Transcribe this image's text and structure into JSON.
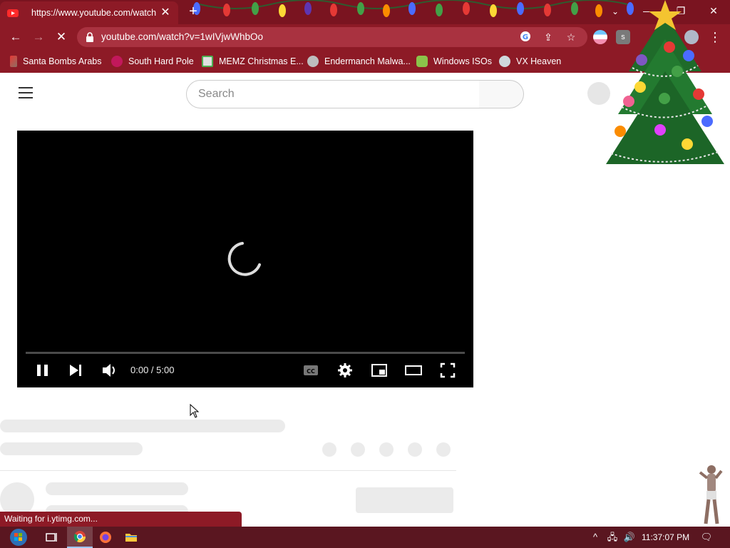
{
  "browser": {
    "tab": {
      "title": "https://www.youtube.com/watch"
    },
    "url": "youtube.com/watch?v=1wIVjwWhbOo",
    "bookmarks": [
      {
        "label": "Santa Bombs Arabs",
        "icon": "bookmark-icon"
      },
      {
        "label": "South Hard Pole",
        "icon": "raspberry-icon"
      },
      {
        "label": "MEMZ Christmas E...",
        "icon": "memz-icon"
      },
      {
        "label": "Endermanch Malwa...",
        "icon": "owl-icon"
      },
      {
        "label": "Windows ISOs",
        "icon": "figure-icon"
      },
      {
        "label": "VX Heaven",
        "icon": "vx-icon"
      }
    ],
    "status": "Waiting for i.ytimg.com..."
  },
  "youtube": {
    "search_placeholder": "Search",
    "player": {
      "time": "0:00 / 5:00",
      "state": "loading"
    }
  },
  "taskbar": {
    "clock": "11:37:07 PM"
  },
  "colors": {
    "chrome_frame": "#8d1a26",
    "tabstrip": "#7a1420",
    "taskbar": "#5a1620",
    "skeleton": "#ebebeb"
  }
}
